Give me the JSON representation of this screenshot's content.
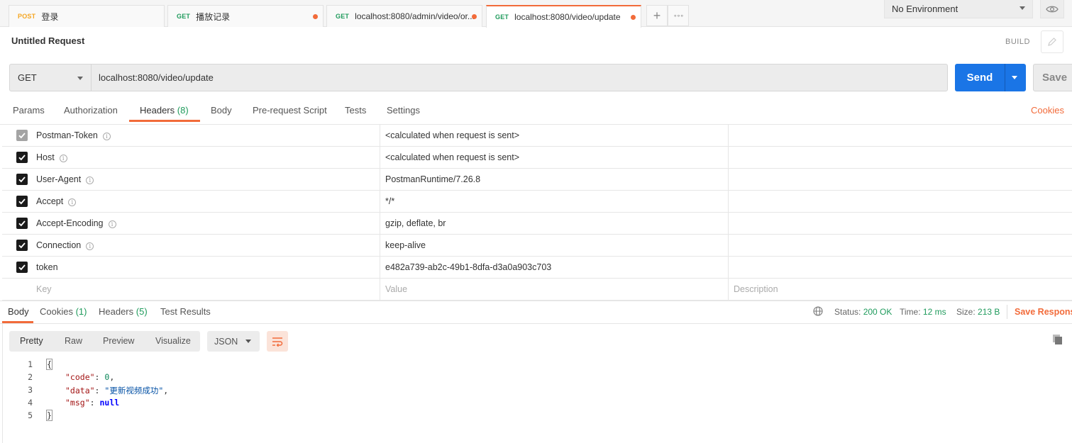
{
  "tabs": [
    {
      "method": "POST",
      "name": "登录",
      "unsaved": false,
      "active": false
    },
    {
      "method": "GET",
      "name": "播放记录",
      "unsaved": true,
      "active": false
    },
    {
      "method": "GET",
      "name": "localhost:8080/admin/video/or...",
      "unsaved": true,
      "active": false
    },
    {
      "method": "GET",
      "name": "localhost:8080/video/update",
      "unsaved": true,
      "active": true
    }
  ],
  "tabbar": {
    "new_tab": "+",
    "more": "∘∘∘"
  },
  "environment": {
    "selected": "No Environment"
  },
  "request": {
    "title": "Untitled Request",
    "build_label": "BUILD",
    "method": "GET",
    "url": "localhost:8080/video/update",
    "send_label": "Send",
    "save_label": "Save"
  },
  "request_tabs": {
    "params": "Params",
    "authorization": "Authorization",
    "headers": "Headers",
    "headers_count": "(8)",
    "body": "Body",
    "prerequest": "Pre-request Script",
    "tests": "Tests",
    "settings": "Settings",
    "cookies": "Cookies"
  },
  "headers_table": {
    "rows": [
      {
        "key": "Postman-Token",
        "value": "<calculated when request is sent>",
        "checked": true,
        "disabled": true,
        "info": true
      },
      {
        "key": "Host",
        "value": "<calculated when request is sent>",
        "checked": true,
        "disabled": false,
        "info": true
      },
      {
        "key": "User-Agent",
        "value": "PostmanRuntime/7.26.8",
        "checked": true,
        "disabled": false,
        "info": true
      },
      {
        "key": "Accept",
        "value": "*/*",
        "checked": true,
        "disabled": false,
        "info": true
      },
      {
        "key": "Accept-Encoding",
        "value": "gzip, deflate, br",
        "checked": true,
        "disabled": false,
        "info": true
      },
      {
        "key": "Connection",
        "value": "keep-alive",
        "checked": true,
        "disabled": false,
        "info": true
      },
      {
        "key": "token",
        "value": "e482a739-ab2c-49b1-8dfa-d3a0a903c703",
        "checked": true,
        "disabled": false,
        "info": false
      }
    ],
    "placeholders": {
      "key": "Key",
      "value": "Value",
      "description": "Description"
    }
  },
  "response": {
    "tabs": {
      "body": "Body",
      "cookies": "Cookies",
      "cookies_count": "(1)",
      "headers": "Headers",
      "headers_count": "(5)",
      "test_results": "Test Results"
    },
    "status_label": "Status:",
    "status_value": "200 OK",
    "time_label": "Time:",
    "time_value": "12 ms",
    "size_label": "Size:",
    "size_value": "213 B",
    "save_response": "Save Response",
    "format_tabs": {
      "pretty": "Pretty",
      "raw": "Raw",
      "preview": "Preview",
      "visualize": "Visualize"
    },
    "format_select": "JSON",
    "body_lines": [
      {
        "n": "1",
        "text": "{"
      },
      {
        "n": "2",
        "key": "\"code\"",
        "value": "0",
        "vtype": "number",
        "comma": true
      },
      {
        "n": "3",
        "key": "\"data\"",
        "value": "\"更新视频成功\"",
        "vtype": "string",
        "comma": true
      },
      {
        "n": "4",
        "key": "\"msg\"",
        "value": "null",
        "vtype": "null",
        "comma": false
      },
      {
        "n": "5",
        "text": "}"
      }
    ]
  },
  "colors": {
    "accent": "#f26b3a",
    "send": "#1a75e6",
    "success": "#1f9b5c",
    "post": "#f5a623"
  }
}
